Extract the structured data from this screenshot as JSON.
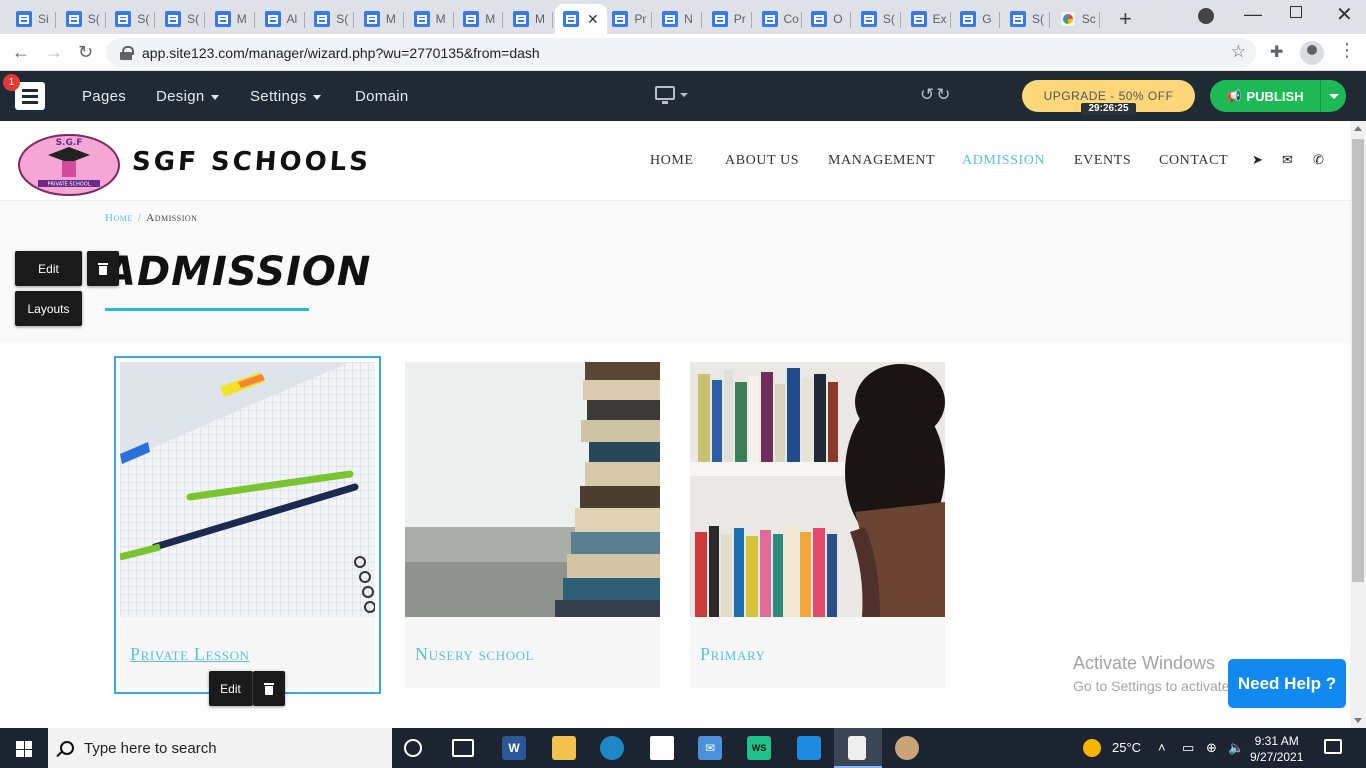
{
  "browser": {
    "tabs": [
      {
        "label": "Si"
      },
      {
        "label": "S("
      },
      {
        "label": "S("
      },
      {
        "label": "S("
      },
      {
        "label": "M"
      },
      {
        "label": "Al"
      },
      {
        "label": "S("
      },
      {
        "label": "M"
      },
      {
        "label": "M"
      },
      {
        "label": "M"
      },
      {
        "label": "M"
      },
      {
        "label": ""
      },
      {
        "label": "Pr"
      },
      {
        "label": "N"
      },
      {
        "label": "Pr"
      },
      {
        "label": "Co"
      },
      {
        "label": "O"
      },
      {
        "label": "S("
      },
      {
        "label": "Ex"
      },
      {
        "label": "G"
      },
      {
        "label": "S("
      },
      {
        "label": "Sc"
      }
    ],
    "active_tab_index": 11,
    "url": "app.site123.com/manager/wizard.php?wu=2770135&from=dash"
  },
  "editor": {
    "notification_count": "1",
    "menu": [
      {
        "label": "Pages",
        "has_caret": false
      },
      {
        "label": "Design",
        "has_caret": true
      },
      {
        "label": "Settings",
        "has_caret": true
      },
      {
        "label": "Domain",
        "has_caret": false
      }
    ],
    "upgrade_label": "UPGRADE - 50% OFF",
    "timer": "29:26:25",
    "publish_label": "PUBLISH",
    "colors": {
      "bar": "#1f2a33",
      "upgrade": "#fdd77a",
      "publish": "#1db954"
    }
  },
  "site": {
    "logo_text": "S.G.F",
    "logo_sub": "PRIVATE SCHOOL",
    "brand": "SGF SCHOOLS",
    "nav": [
      {
        "label": "HOME",
        "active": false
      },
      {
        "label": "ABOUT US",
        "active": false
      },
      {
        "label": "MANAGEMENT",
        "active": false
      },
      {
        "label": "ADMISSION",
        "active": true
      },
      {
        "label": "EVENTS",
        "active": false
      },
      {
        "label": "CONTACT",
        "active": false
      }
    ],
    "nav_icons": [
      "location-arrow-icon",
      "envelope-icon",
      "phone-icon"
    ],
    "breadcrumb": {
      "home": "Home",
      "separator": "/",
      "current": "Admission"
    },
    "page_title": "ADMISSION",
    "accent_color": "#5bc0de",
    "cards": [
      {
        "label": "Private Lesson",
        "image": "notebook-with-pencils",
        "selected": true
      },
      {
        "label": "Nusery school",
        "image": "stack-of-books",
        "selected": false
      },
      {
        "label": "Primary",
        "image": "girl-at-bookshelf",
        "selected": false
      }
    ]
  },
  "section_tools": {
    "edit": "Edit",
    "layouts": "Layouts"
  },
  "card_tools": {
    "edit": "Edit"
  },
  "watermark": {
    "line1": "Activate Windows",
    "line2": "Go to Settings to activate Windows."
  },
  "help_button": "Need Help ?",
  "taskbar": {
    "search_placeholder": "Type here to search",
    "temperature": "25°C",
    "time": "9:31 AM",
    "date": "9/27/2021"
  }
}
